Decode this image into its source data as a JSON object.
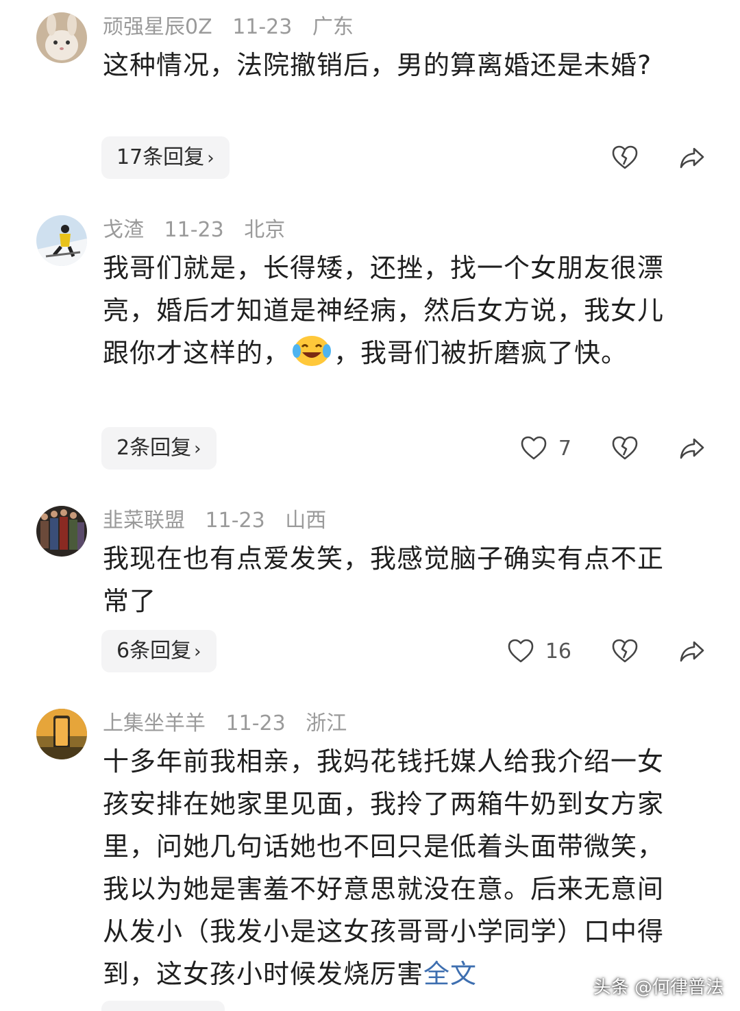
{
  "comments": [
    {
      "username": "顽强星辰0Z",
      "date": "11-23",
      "location": "广东",
      "text": "这种情况，法院撤销后，男的算离婚还是未婚?",
      "replies": "17条回复",
      "likes": "",
      "avatar": "rabbit-avatar"
    },
    {
      "username": "戈渣",
      "date": "11-23",
      "location": "北京",
      "text_before_emoji": "我哥们就是，长得矮，还挫，找一个女朋友很漂亮，婚后才知道是神经病，然后女方说，我女儿跟你才这样的，",
      "text_after_emoji": "，我哥们被折磨疯了快。",
      "emoji": "laugh-cry-emoji",
      "replies": "2条回复",
      "likes": "7",
      "avatar": "skier-avatar"
    },
    {
      "username": "韭菜联盟",
      "date": "11-23",
      "location": "山西",
      "text": "我现在也有点爱发笑，我感觉脑子确实有点不正常了",
      "replies": "6条回复",
      "likes": "16",
      "avatar": "heroes-avatar"
    },
    {
      "username": "上集坐羊羊",
      "date": "11-23",
      "location": "浙江",
      "text": "十多年前我相亲，我妈花钱托媒人给我介绍一女孩安排在她家里见面，我拎了两箱牛奶到女方家里，问她几句话她也不回只是低着头面带微笑，我以为她是害羞不好意思就没在意。后来无意间从发小（我发小是这女孩哥哥小学同学）口中得到，这女孩小时候发烧厉害",
      "more": "全文",
      "avatar": "phone-sunset-avatar"
    }
  ],
  "reply_chevron": "›",
  "watermark": "头条 @何律普法",
  "icons": {
    "like": "heart-icon",
    "dislike": "broken-heart-icon",
    "share": "share-icon"
  }
}
